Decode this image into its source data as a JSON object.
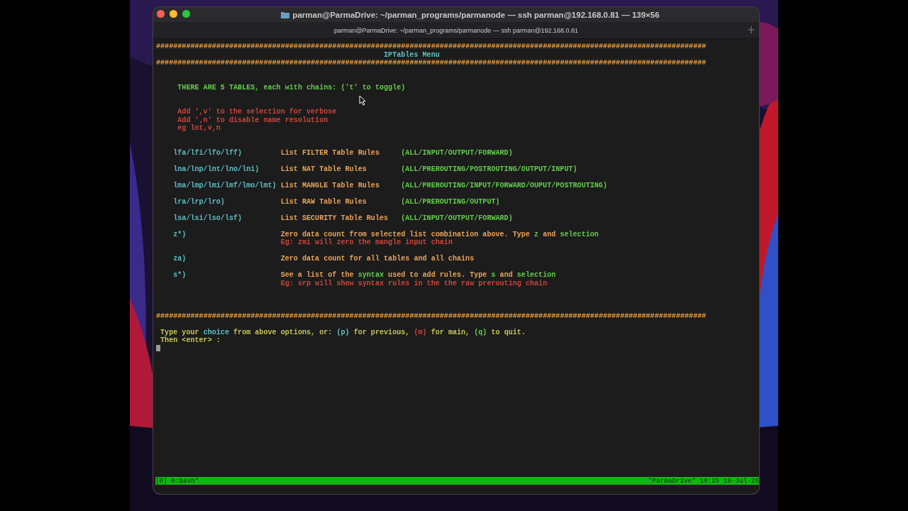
{
  "window": {
    "title": "parman@ParmaDrive: ~/parman_programs/parmanode — ssh parman@192.168.0.81 — 139×56",
    "tab_title": "parman@ParmaDrive: ~/parman_programs/parmanode — ssh parman@192.168.0.81"
  },
  "terminal": {
    "lines": [
      {
        "kind": "rule",
        "text": "################################################################################################################################",
        "color": "#e59a3a"
      },
      {
        "kind": "title",
        "text": "IPTables Menu",
        "color": "#5cc3c3"
      },
      {
        "kind": "rule",
        "text": "################################################################################################################################",
        "color": "#e59a3a"
      },
      {
        "kind": "blank"
      },
      {
        "kind": "blank"
      },
      {
        "kind": "notice",
        "segments": [
          {
            "text": "THERE ARE 5 TABLES, each with chains: ('t' to toggle)",
            "color": "#62cc4c"
          }
        ]
      },
      {
        "kind": "blank"
      },
      {
        "kind": "blank"
      },
      {
        "kind": "notice",
        "segments": [
          {
            "text": "Add ',v' to the selection for verbose",
            "color": "#c9453a"
          }
        ]
      },
      {
        "kind": "notice",
        "segments": [
          {
            "text": "Add ',n' to disable name resolution",
            "color": "#c9453a"
          }
        ]
      },
      {
        "kind": "notice",
        "segments": [
          {
            "text": "eg lnt,v,n",
            "color": "#c9453a"
          }
        ]
      },
      {
        "kind": "blank"
      },
      {
        "kind": "blank"
      },
      {
        "kind": "option",
        "key": "lfa/lfi/lfo/lff)",
        "description": [
          {
            "text": "List FILTER Table Rules",
            "color": "#e9a35a"
          }
        ],
        "chains": "(ALL/INPUT/OUTPUT/FORWARD)"
      },
      {
        "kind": "blank"
      },
      {
        "kind": "option",
        "key": "lna/lnp/lnt/lno/lni)",
        "description": [
          {
            "text": "List NAT Table Rules",
            "color": "#e9a35a"
          }
        ],
        "chains": "(ALL/PREROUTING/POSTROUTING/OUTPUT/INPUT)"
      },
      {
        "kind": "blank"
      },
      {
        "kind": "option",
        "key": "lma/lmp/lmi/lmf/lmo/lmt)",
        "description": [
          {
            "text": "List MANGLE Table Rules",
            "color": "#e9a35a"
          }
        ],
        "chains": "(ALL/PREROUTING/INPUT/FORWARD/OUPUT/POSTROUTING)"
      },
      {
        "kind": "blank"
      },
      {
        "kind": "option",
        "key": "lra/lrp/lro)",
        "description": [
          {
            "text": "List RAW Table Rules",
            "color": "#e9a35a"
          }
        ],
        "chains": "(ALL/PREROUTING/OUTPUT)"
      },
      {
        "kind": "blank"
      },
      {
        "kind": "option",
        "key": "lsa/lsi/lso/lsf)",
        "description": [
          {
            "text": "List SECURITY Table Rules",
            "color": "#e9a35a"
          }
        ],
        "chains": "(ALL/INPUT/OUTPUT/FORWARD)"
      },
      {
        "kind": "blank"
      },
      {
        "kind": "option",
        "key": "z*)",
        "description": [
          {
            "text": "Zero data count from selected list combination above. Type ",
            "color": "#e9a35a"
          },
          {
            "text": "z",
            "color": "#62cc4c"
          },
          {
            "text": " and ",
            "color": "#e9a35a"
          },
          {
            "text": "selection",
            "color": "#62cc4c"
          }
        ]
      },
      {
        "kind": "note",
        "segments": [
          {
            "text": "Eg: zmi will zero the mangle input chain",
            "color": "#c9453a"
          }
        ]
      },
      {
        "kind": "blank"
      },
      {
        "kind": "option",
        "key": "za)",
        "description": [
          {
            "text": "Zero data count for all tables and all chains",
            "color": "#e9a35a"
          }
        ]
      },
      {
        "kind": "blank"
      },
      {
        "kind": "option",
        "key": "s*)",
        "description": [
          {
            "text": "See a list of the ",
            "color": "#e9a35a"
          },
          {
            "text": "syntax",
            "color": "#62cc4c"
          },
          {
            "text": " used to add rules. Type ",
            "color": "#e9a35a"
          },
          {
            "text": "s",
            "color": "#62cc4c"
          },
          {
            "text": " and ",
            "color": "#e9a35a"
          },
          {
            "text": "selection",
            "color": "#62cc4c"
          }
        ]
      },
      {
        "kind": "note",
        "segments": [
          {
            "text": "Eg: srp will show syntax rules in the the raw prerouting chain",
            "color": "#c9453a"
          }
        ]
      },
      {
        "kind": "blank"
      },
      {
        "kind": "blank"
      },
      {
        "kind": "blank"
      },
      {
        "kind": "rule",
        "text": "################################################################################################################################",
        "color": "#e59a3a"
      },
      {
        "kind": "blank"
      },
      {
        "kind": "prompt",
        "segments": [
          {
            "text": "Type your ",
            "color": "#c4c456"
          },
          {
            "text": "choice",
            "color": "#5cc3c3"
          },
          {
            "text": " from above options, or: ",
            "color": "#c4c456"
          },
          {
            "text": "(p)",
            "color": "#5cc3c3"
          },
          {
            "text": " for previous, ",
            "color": "#c4c456"
          },
          {
            "text": "(m)",
            "color": "#c9453a"
          },
          {
            "text": " for main, ",
            "color": "#c4c456"
          },
          {
            "text": "(q)",
            "color": "#62cc4c"
          },
          {
            "text": " to quit.",
            "color": "#c4c456"
          }
        ]
      },
      {
        "kind": "prompt",
        "segments": [
          {
            "text": "Then <enter> :",
            "color": "#c4c456"
          }
        ]
      },
      {
        "kind": "cursor"
      }
    ]
  },
  "status_bar": {
    "left": "[0] 0:bash*",
    "right": "\"ParmaDrive\" 10:25 16-Jul-25"
  }
}
